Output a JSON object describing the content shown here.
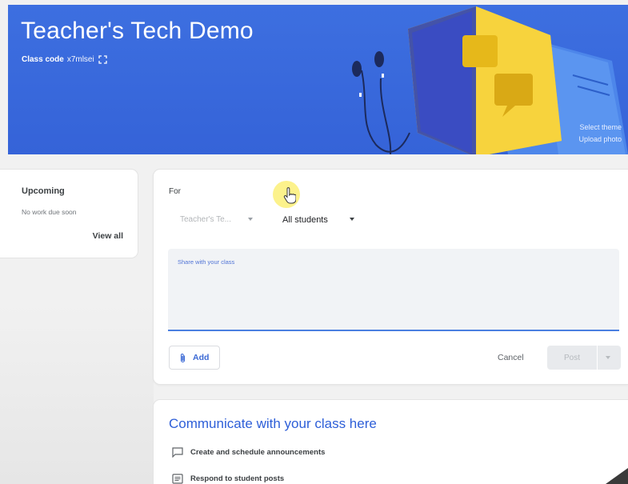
{
  "header": {
    "class_title": "Teacher's Tech Demo",
    "class_code_label": "Class code",
    "class_code_value": "x7mlsei",
    "select_theme": "Select theme",
    "upload_photo": "Upload photo"
  },
  "upcoming": {
    "title": "Upcoming",
    "subtitle": "No work due soon",
    "view_all": "View all"
  },
  "composer": {
    "for_label": "For",
    "class_select_value": "Teacher's Te...",
    "students_select_value": "All students",
    "share_placeholder": "Share with your class",
    "add_label": "Add",
    "cancel_label": "Cancel",
    "post_label": "Post"
  },
  "communicate": {
    "title": "Communicate with your class here",
    "items": [
      {
        "label": "Create and schedule announcements",
        "icon": "announcement-icon"
      },
      {
        "label": "Respond to student posts",
        "icon": "post-icon"
      }
    ]
  },
  "colors": {
    "banner": "#3563d8",
    "accent": "#2e5fd8",
    "cursor_highlight": "#fcf078"
  }
}
